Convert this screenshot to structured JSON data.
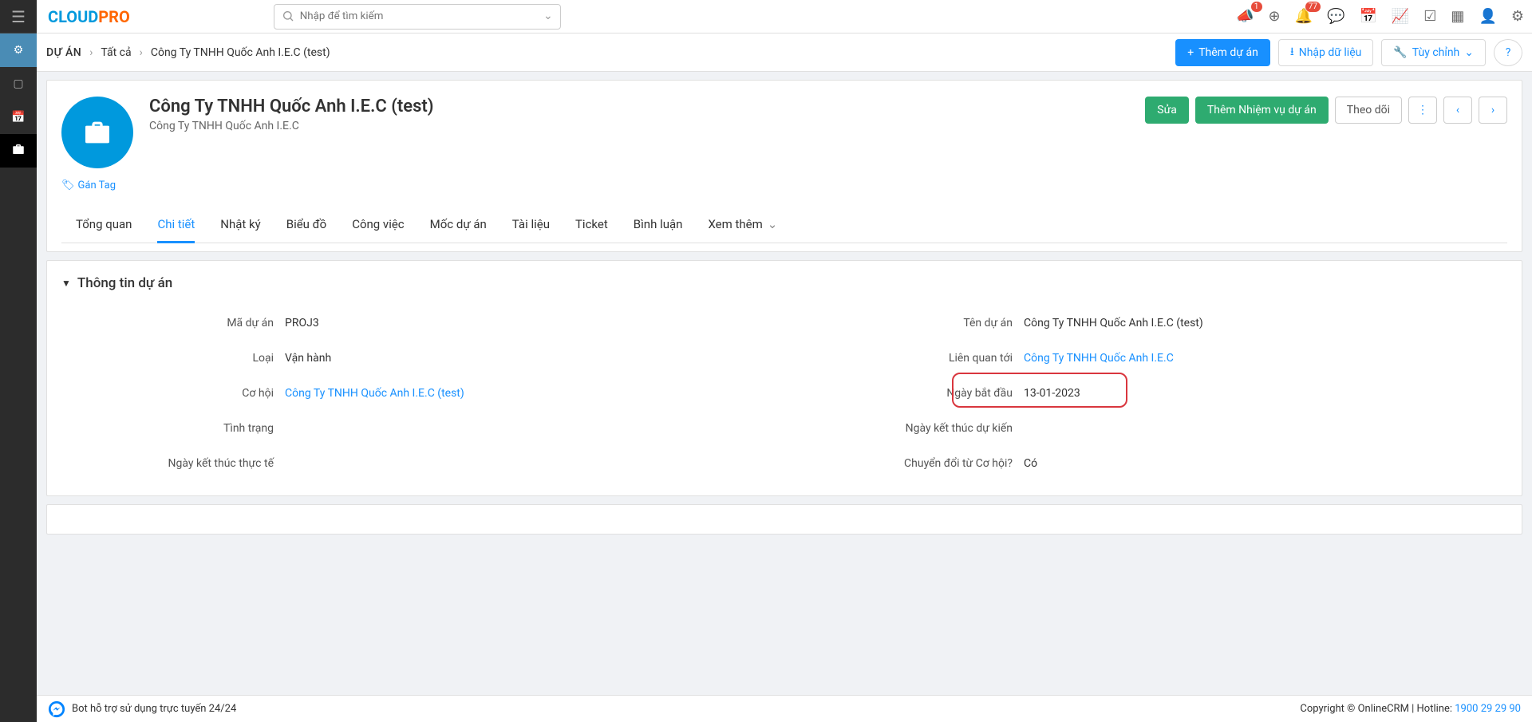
{
  "topbar": {
    "search_placeholder": "Nhập để tìm kiếm",
    "badge_megaphone": "1",
    "badge_bell": "77"
  },
  "breadcrumb": {
    "root": "DỰ ÁN",
    "level1": "Tất cả",
    "level2": "Công Ty TNHH Quốc Anh I.E.C (test)"
  },
  "actions": {
    "add_project": "Thêm dự án",
    "import_data": "Nhập dữ liệu",
    "customize": "Tùy chỉnh"
  },
  "header": {
    "title": "Công Ty TNHH Quốc Anh I.E.C (test)",
    "subtitle": "Công Ty TNHH Quốc Anh I.E.C",
    "tag_link": "Gán Tag",
    "btn_edit": "Sửa",
    "btn_add_task": "Thêm Nhiệm vụ dự án",
    "btn_follow": "Theo dõi"
  },
  "tabs": {
    "overview": "Tổng quan",
    "detail": "Chi tiết",
    "log": "Nhật ký",
    "chart": "Biểu đồ",
    "work": "Công việc",
    "milestone": "Mốc dự án",
    "document": "Tài liệu",
    "ticket": "Ticket",
    "comment": "Bình luận",
    "more": "Xem thêm"
  },
  "section": {
    "title": "Thông tin dự án"
  },
  "fields": {
    "code_label": "Mã dự án",
    "code_val": "PROJ3",
    "name_label": "Tên dự án",
    "name_val": "Công Ty TNHH Quốc Anh I.E.C (test)",
    "type_label": "Loại",
    "type_val": "Vận hành",
    "related_label": "Liên quan tới",
    "related_val": "Công Ty TNHH Quốc Anh I.E.C",
    "opportunity_label": "Cơ hội",
    "opportunity_val": "Công Ty TNHH Quốc Anh I.E.C (test)",
    "start_label": "Ngày bắt đầu",
    "start_val": "13-01-2023",
    "status_label": "Tình trạng",
    "status_val": "",
    "expected_end_label": "Ngày kết thúc dự kiến",
    "expected_end_val": "",
    "actual_end_label": "Ngày kết thúc thực tế",
    "actual_end_val": "",
    "converted_label": "Chuyển đổi từ Cơ hội?",
    "converted_val": "Có"
  },
  "footer": {
    "bot": "Bot hỗ trợ sử dụng trực tuyến 24/24",
    "copyright": "Copyright © OnlineCRM | Hotline: ",
    "hotline": "1900 29 29 90"
  }
}
